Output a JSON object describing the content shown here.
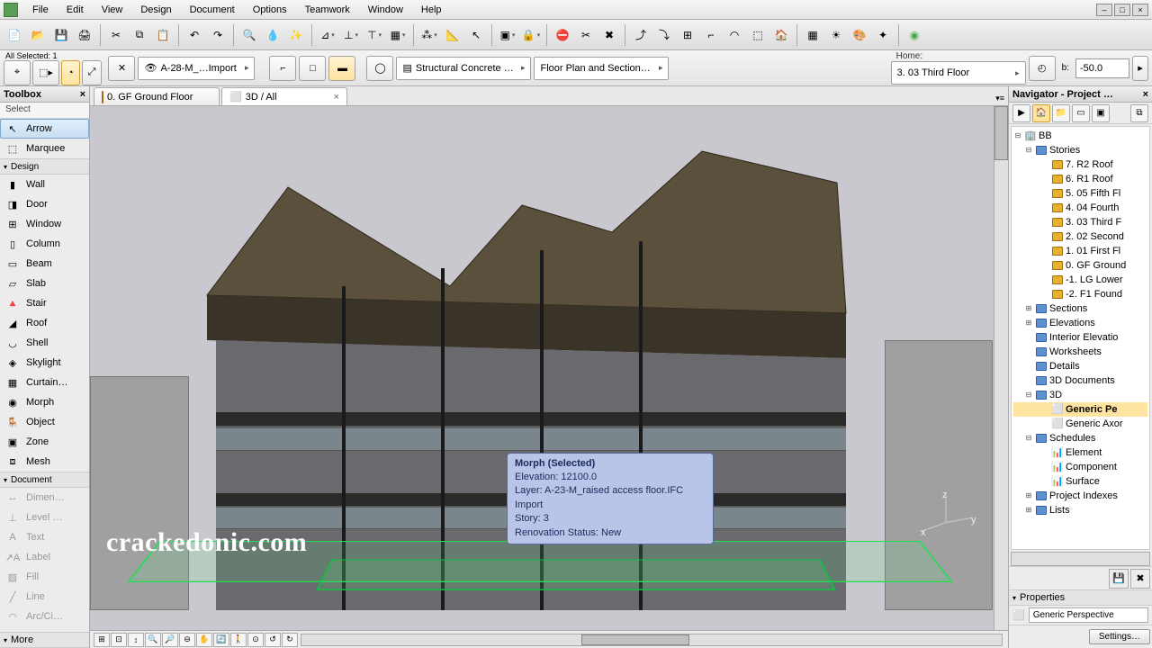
{
  "menu": {
    "items": [
      "File",
      "Edit",
      "View",
      "Design",
      "Document",
      "Options",
      "Teamwork",
      "Window",
      "Help"
    ]
  },
  "infobar": {
    "all_selected": "All Selected: 1",
    "layer_dd": "A-28-M_…Import",
    "material_dd": "Structural Concrete …",
    "view_dd": "Floor Plan and Section…",
    "home_label": "Home:",
    "story_dd": "3. 03 Third Floor",
    "b_label": "b:",
    "b_value": "-50.0"
  },
  "toolbox": {
    "title": "Toolbox",
    "select_label": "Select",
    "arrow": "Arrow",
    "marquee": "Marquee",
    "design_label": "Design",
    "design_tools": [
      "Wall",
      "Door",
      "Window",
      "Column",
      "Beam",
      "Slab",
      "Stair",
      "Roof",
      "Shell",
      "Skylight",
      "Curtain…",
      "Morph",
      "Object",
      "Zone",
      "Mesh"
    ],
    "document_label": "Document",
    "doc_tools": [
      "Dimen…",
      "Level …",
      "Text",
      "Label",
      "Fill",
      "Line",
      "Arc/Ci…"
    ],
    "more": "More"
  },
  "tabs": {
    "t1": "0. GF Ground Floor",
    "t2": "3D / All"
  },
  "tooltip": {
    "title": "Morph (Selected)",
    "l1": "Elevation: 12100.0",
    "l2": "Layer: A-23-M_raised access floor.IFC Import",
    "l3": "Story: 3",
    "l4": "Renovation Status: New"
  },
  "watermark": "crackedonic.com",
  "navigator": {
    "title": "Navigator - Project …",
    "root": "BB",
    "stories_label": "Stories",
    "stories": [
      "7. R2 Roof",
      "6. R1 Roof",
      "5. 05 Fifth Fl",
      "4. 04 Fourth",
      "3. 03 Third F",
      "2. 02 Second",
      "1. 01 First Fl",
      "0. GF Ground",
      "-1. LG Lower",
      "-2. F1 Found"
    ],
    "sections": "Sections",
    "elevations": "Elevations",
    "interior": "Interior Elevatio",
    "worksheets": "Worksheets",
    "details": "Details",
    "threed_docs": "3D Documents",
    "threed": "3D",
    "threed_items": [
      "Generic Pe",
      "Generic Axor"
    ],
    "schedules": "Schedules",
    "sched_items": [
      "Element",
      "Component",
      "Surface"
    ],
    "proj_idx": "Project Indexes",
    "lists": "Lists",
    "settings_btn": "Settings…",
    "properties": "Properties",
    "prop_value": "Generic Perspective"
  }
}
